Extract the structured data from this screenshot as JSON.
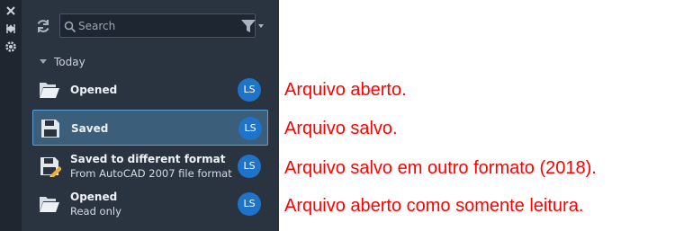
{
  "strip": {
    "icons": [
      "close-icon",
      "collapse-icon",
      "settings-icon"
    ]
  },
  "toolbar": {
    "search_placeholder": "Search"
  },
  "group": {
    "label": "Today"
  },
  "items": [
    {
      "title": "Opened",
      "subtitle": "",
      "avatar": "LS",
      "icon": "folder-open-icon"
    },
    {
      "title": "Saved",
      "subtitle": "",
      "avatar": "LS",
      "icon": "floppy-disk-icon"
    },
    {
      "title": "Saved to different format",
      "subtitle": "From AutoCAD 2007 file format",
      "avatar": "LS",
      "icon": "floppy-disk-edit-icon"
    },
    {
      "title": "Opened",
      "subtitle": "Read only",
      "avatar": "LS",
      "icon": "folder-open-icon"
    }
  ],
  "annotations": [
    "Arquivo aberto.",
    "Arquivo salvo.",
    "Arquivo salvo em outro formato (2018).",
    "Arquivo aberto como somente leitura."
  ],
  "colors": {
    "panel": "#2a3441",
    "strip": "#1f2630",
    "selected": "#3b5f7a",
    "selected_border": "#5aa0d8",
    "avatar": "#1e74c8",
    "annotation": "#ff0000"
  }
}
